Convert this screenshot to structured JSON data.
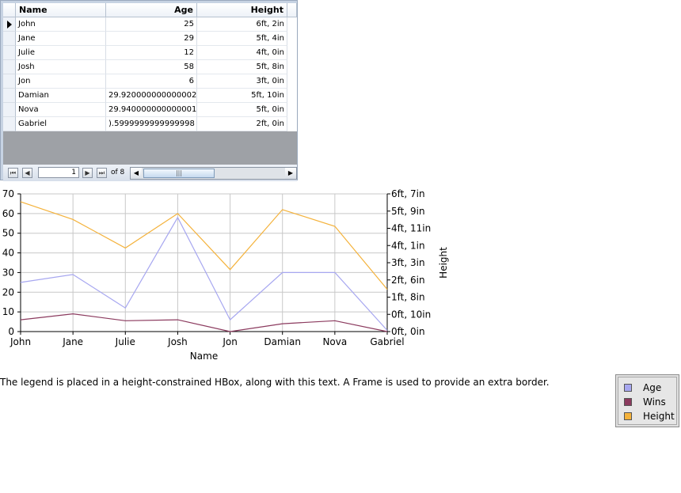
{
  "grid": {
    "columns": [
      {
        "label": "Name"
      },
      {
        "label": "Age"
      },
      {
        "label": "Height"
      }
    ],
    "rows": [
      {
        "name": "John",
        "age": "25",
        "height": "6ft,  2in"
      },
      {
        "name": "Jane",
        "age": "29",
        "height": "5ft,  4in"
      },
      {
        "name": "Julie",
        "age": "12",
        "height": "4ft,  0in"
      },
      {
        "name": "Josh",
        "age": "58",
        "height": "5ft,  8in"
      },
      {
        "name": "Jon",
        "age": "6",
        "height": "3ft,  0in"
      },
      {
        "name": "Damian",
        "age": "29.920000000000002",
        "height": "5ft, 10in"
      },
      {
        "name": "Nova",
        "age": "29.940000000000001",
        "height": "5ft,  0in"
      },
      {
        "name": "Gabriel",
        "age": ").5999999999999998",
        "height": "2ft,  0in"
      }
    ],
    "pager": {
      "first": "⏮",
      "prev": "◀",
      "next": "▶",
      "last": "⏭",
      "page": "1",
      "of_label": "of 8",
      "scroll_left": "◀",
      "scroll_right": "▶",
      "thumb_grip": "|||"
    }
  },
  "chart_data": {
    "type": "line",
    "categories": [
      "John",
      "Jane",
      "Julie",
      "Josh",
      "Jon",
      "Damian",
      "Nova",
      "Gabriel"
    ],
    "xlabel": "Name",
    "ylabel_right": "Height",
    "y_left": {
      "min": 0,
      "max": 70,
      "ticks": [
        "0",
        "10",
        "20",
        "30",
        "40",
        "50",
        "60",
        "70"
      ]
    },
    "y_right": {
      "ticks": [
        "0ft,  0in",
        "0ft, 10in",
        "1ft,  8in",
        "2ft,  6in",
        "3ft,  3in",
        "4ft,  1in",
        "4ft, 11in",
        "5ft,  9in",
        "6ft,  7in"
      ]
    },
    "series": [
      {
        "name": "Age",
        "color": "#a7a7f0",
        "axis": "left",
        "values": [
          25,
          29,
          12,
          58,
          6,
          30,
          30,
          0.6
        ]
      },
      {
        "name": "Wins",
        "color": "#8b3a5e",
        "axis": "left",
        "values": [
          6,
          9,
          5.5,
          6,
          0,
          4,
          5.5,
          0
        ]
      },
      {
        "name": "Height",
        "color": "#f4b23b",
        "axis": "left",
        "values": [
          66,
          57,
          42.5,
          60,
          31.5,
          62,
          53.5,
          21.5
        ]
      }
    ]
  },
  "note": "The legend is placed in a height-constrained HBox, along with this text. A Frame is used to provide an extra border.",
  "legend": [
    {
      "label": "Age",
      "color": "#a7a7f0"
    },
    {
      "label": "Wins",
      "color": "#8b3a5e"
    },
    {
      "label": "Height",
      "color": "#f4b23b"
    }
  ]
}
